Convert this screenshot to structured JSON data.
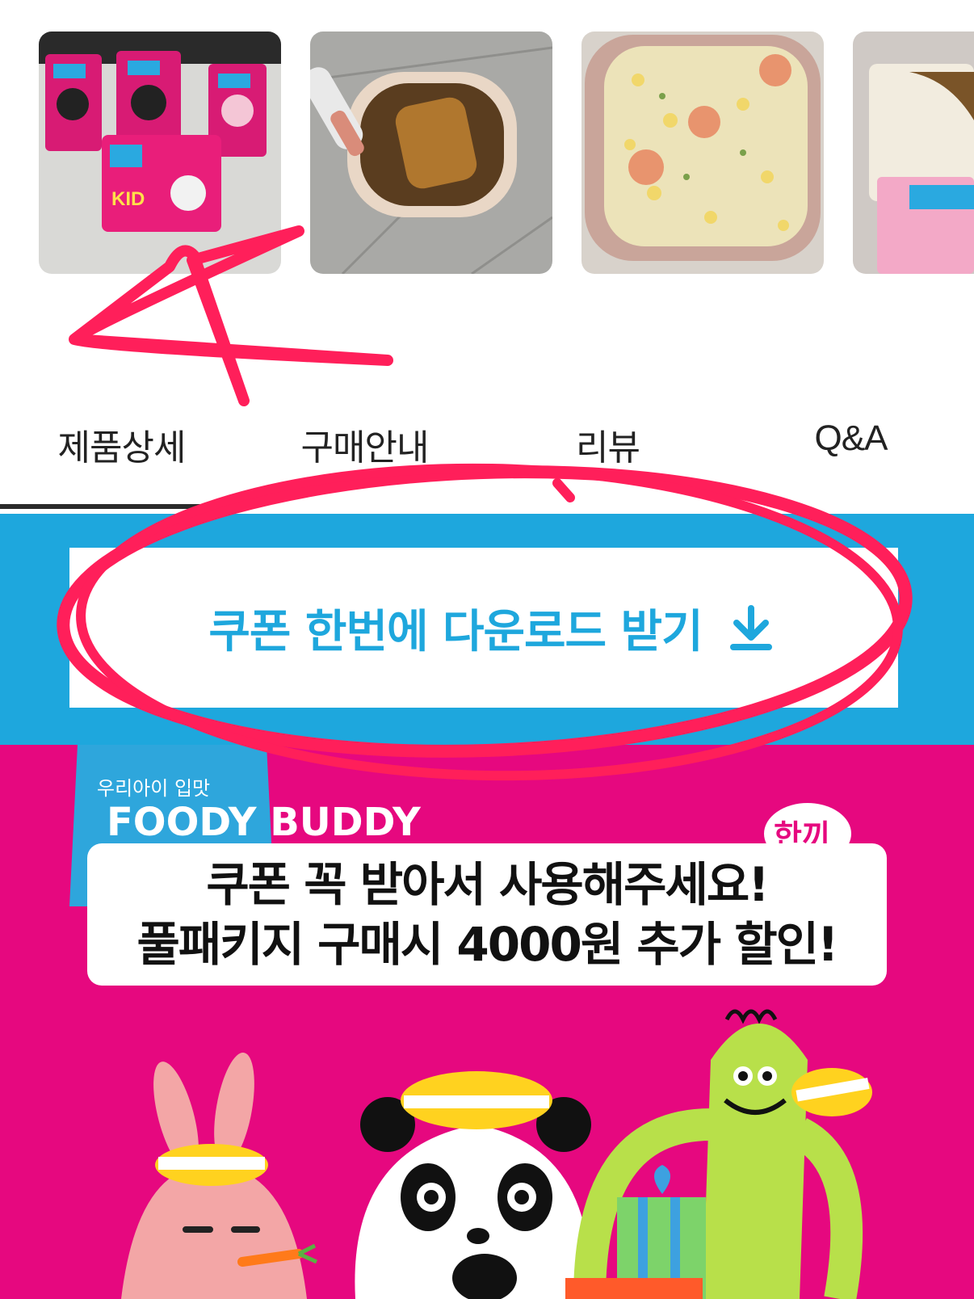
{
  "thumbnails": [
    {
      "name": "product-package-photo"
    },
    {
      "name": "tonkatsu-curry-photo"
    },
    {
      "name": "shrimp-fried-rice-photo"
    },
    {
      "name": "rice-bowl-photo"
    }
  ],
  "tabs": [
    {
      "label": "제품상세",
      "active": true
    },
    {
      "label": "구매안내",
      "active": false
    },
    {
      "label": "리뷰",
      "active": false
    },
    {
      "label": "Q&A",
      "active": false
    }
  ],
  "coupon": {
    "label": "쿠폰 한번에 다운로드 받기",
    "icon": "download-arrow-icon"
  },
  "promo": {
    "line1": "쿠폰 꼭 받아서 사용해주세요!",
    "line2": "풀패키지 구매시 4000원 추가 할인!",
    "brand": "FOODY BUDDY",
    "brand_tagline": "우리아이 입맛",
    "badge": "한끼"
  },
  "colors": {
    "accent_blue": "#1ea7dd",
    "promo_pink": "#e6087f",
    "annotation_red": "#ff1f5a"
  }
}
